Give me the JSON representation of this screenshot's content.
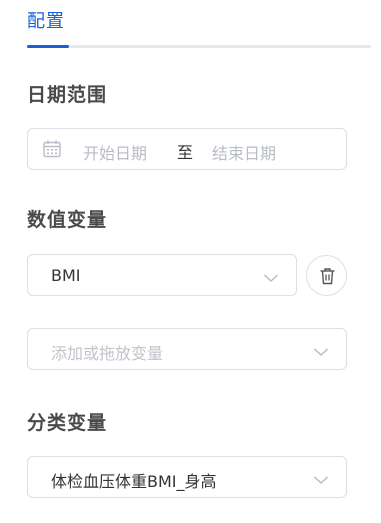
{
  "tabs": [
    {
      "label": "配置",
      "active": true
    }
  ],
  "date_range": {
    "title": "日期范围",
    "start_placeholder": "开始日期",
    "separator": "至",
    "end_placeholder": "结束日期",
    "icon": "calendar-icon"
  },
  "numeric_var": {
    "title": "数值变量",
    "selected": "BMI",
    "delete_icon": "trash-icon",
    "add_placeholder": "添加或拖放变量"
  },
  "category_var": {
    "title": "分类变量",
    "selected": "体检血压体重BMI_身高"
  },
  "colors": {
    "accent": "#1761d8",
    "border": "#dcdfe6",
    "placeholder": "#b8bcc4",
    "heading": "#4a4a4a"
  }
}
